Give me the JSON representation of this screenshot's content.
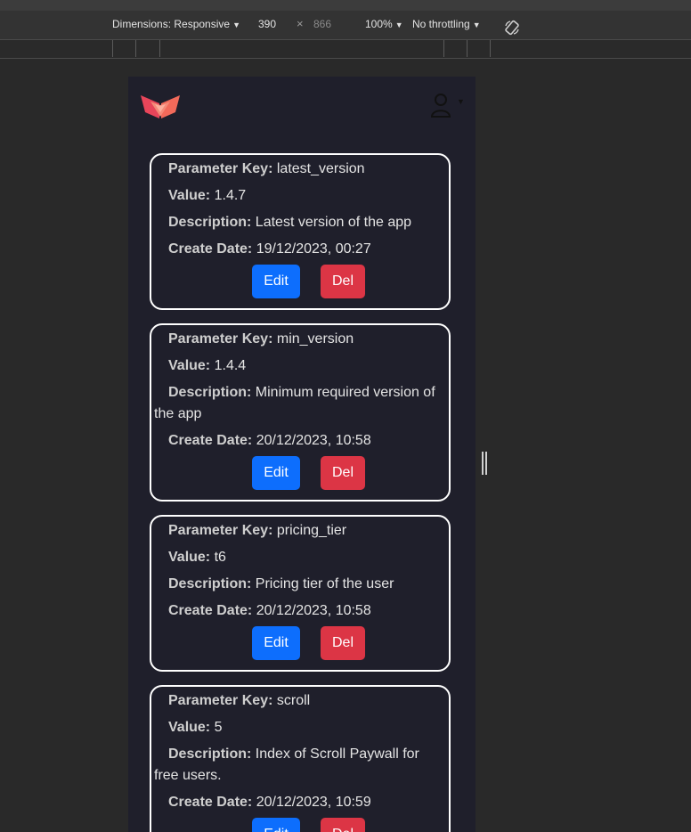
{
  "devtools": {
    "dimensions_label": "Dimensions: Responsive",
    "width": "390",
    "times": "×",
    "height": "866",
    "zoom": "100%",
    "throttling": "No throttling",
    "rotate_icon": "rotate-icon"
  },
  "app": {
    "logo_icon": "logo-icon",
    "user_icon": "user-icon",
    "accent": "#f04e5e"
  },
  "labels": {
    "key": "Parameter Key:",
    "value": "Value:",
    "description": "Description:",
    "create_date": "Create Date:",
    "edit": "Edit",
    "delete": "Del"
  },
  "parameters": [
    {
      "key": "latest_version",
      "value": "1.4.7",
      "description": "Latest version of the app",
      "create_date": "19/12/2023, 00:27"
    },
    {
      "key": "min_version",
      "value": "1.4.4",
      "description": "Minimum required version of the app",
      "create_date": "20/12/2023, 10:58"
    },
    {
      "key": "pricing_tier",
      "value": "t6",
      "description": "Pricing tier of the user",
      "create_date": "20/12/2023, 10:58"
    },
    {
      "key": "scroll",
      "value": "5",
      "description": "Index of Scroll Paywall for free users.",
      "create_date": "20/12/2023, 10:59"
    }
  ],
  "colors": {
    "edit": "#0d6efd",
    "delete": "#dc3545",
    "card_border": "#ffffff",
    "background": "#1f1f2b"
  }
}
